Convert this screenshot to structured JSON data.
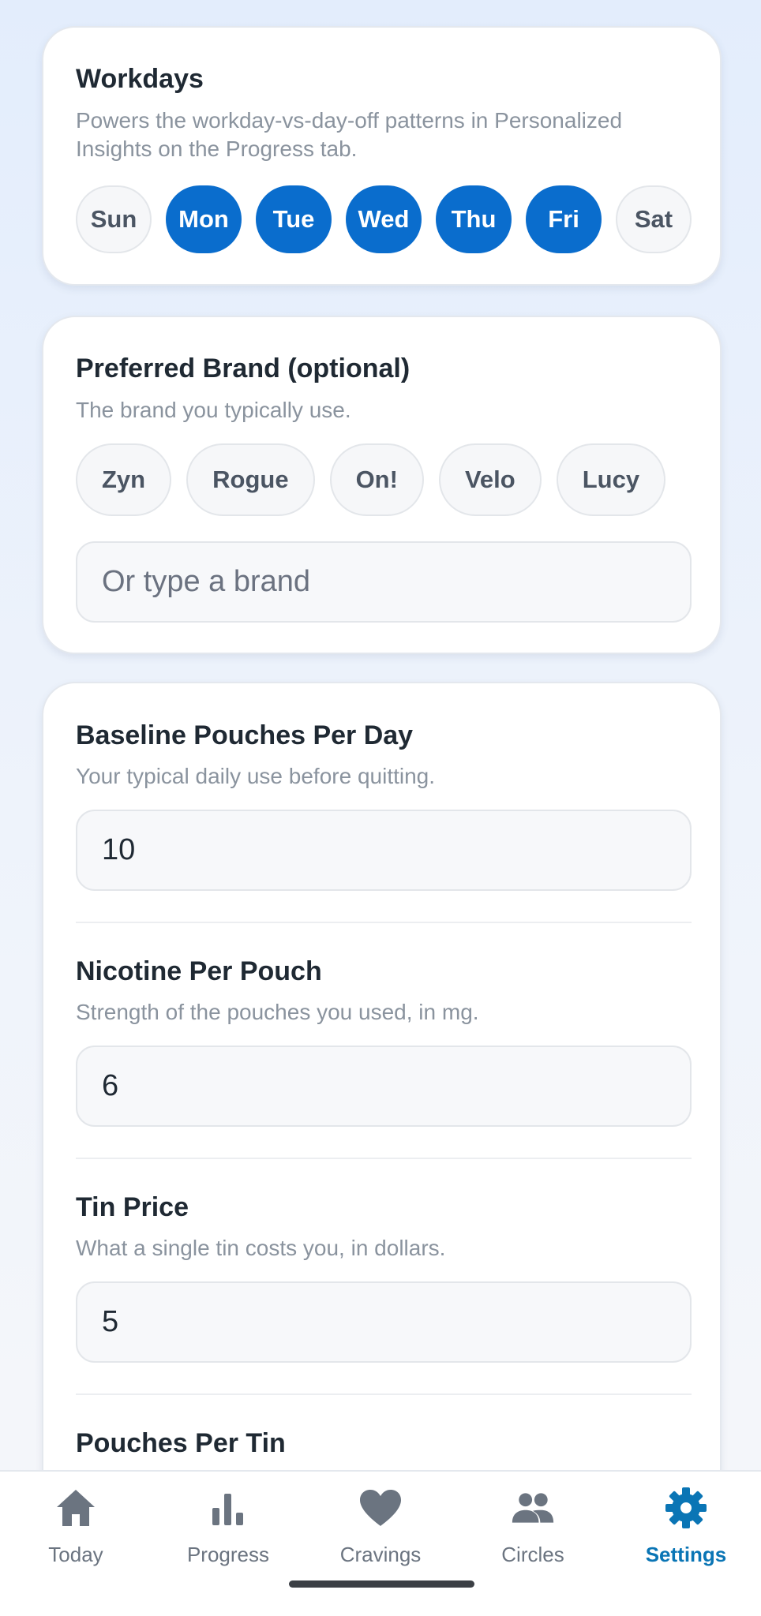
{
  "workdays": {
    "title": "Workdays",
    "description": "Powers the workday-vs-day-off patterns in Personalized Insights on the Progress tab.",
    "days": [
      {
        "label": "Sun",
        "selected": false
      },
      {
        "label": "Mon",
        "selected": true
      },
      {
        "label": "Tue",
        "selected": true
      },
      {
        "label": "Wed",
        "selected": true
      },
      {
        "label": "Thu",
        "selected": true
      },
      {
        "label": "Fri",
        "selected": true
      },
      {
        "label": "Sat",
        "selected": false
      }
    ]
  },
  "brand": {
    "title": "Preferred Brand (optional)",
    "description": "The brand you typically use.",
    "options": [
      "Zyn",
      "Rogue",
      "On!",
      "Velo",
      "Lucy"
    ],
    "input_placeholder": "Or type a brand",
    "input_value": ""
  },
  "usage": {
    "baseline": {
      "title": "Baseline Pouches Per Day",
      "description": "Your typical daily use before quitting.",
      "value": "10"
    },
    "nicotine": {
      "title": "Nicotine Per Pouch",
      "description": "Strength of the pouches you used, in mg.",
      "value": "6"
    },
    "tin_price": {
      "title": "Tin Price",
      "description": "What a single tin costs you, in dollars.",
      "value": "5"
    },
    "pouches_per_tin": {
      "title": "Pouches Per Tin"
    }
  },
  "nav": {
    "items": [
      {
        "label": "Today",
        "icon": "home-icon",
        "active": false
      },
      {
        "label": "Progress",
        "icon": "bar-chart-icon",
        "active": false
      },
      {
        "label": "Cravings",
        "icon": "heart-icon",
        "active": false
      },
      {
        "label": "Circles",
        "icon": "people-icon",
        "active": false
      },
      {
        "label": "Settings",
        "icon": "gear-icon",
        "active": true
      }
    ]
  },
  "colors": {
    "accent": "#0a6dcd",
    "nav_active": "#0a75b5",
    "nav_inactive": "#6b7480"
  }
}
